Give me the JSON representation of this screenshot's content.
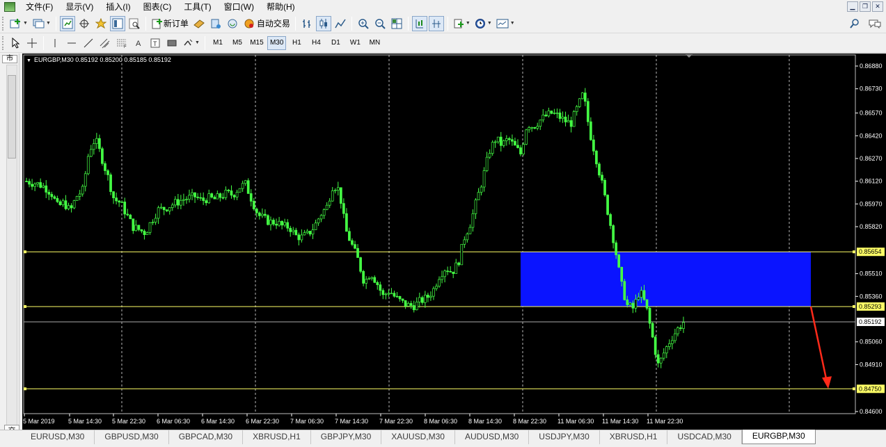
{
  "menu": [
    "文件(F)",
    "显示(V)",
    "插入(I)",
    "图表(C)",
    "工具(T)",
    "窗口(W)",
    "帮助(H)"
  ],
  "toolbar": {
    "new_order_label": "新订单",
    "auto_trading_label": "自动交易"
  },
  "timeframes": [
    "M1",
    "M5",
    "M15",
    "M30",
    "H1",
    "H4",
    "D1",
    "W1",
    "MN"
  ],
  "active_timeframe": "M30",
  "left_panel": {
    "tab_top": "市",
    "tab_bottom": "交"
  },
  "chart": {
    "title": "EURGBP,M30  0.85192 0.85200 0.85185 0.85192"
  },
  "chart_data": {
    "type": "candlestick",
    "symbol": "EURGBP",
    "timeframe": "M30",
    "ohlc_shown": {
      "open": 0.85192,
      "high": 0.852,
      "low": 0.85185,
      "close": 0.85192
    },
    "x_tick_labels": [
      "5 Mar 2019",
      "5 Mar 14:30",
      "5 Mar 22:30",
      "6 Mar 06:30",
      "6 Mar 14:30",
      "6 Mar 22:30",
      "7 Mar 06:30",
      "7 Mar 14:30",
      "7 Mar 22:30",
      "8 Mar 06:30",
      "8 Mar 14:30",
      "8 Mar 22:30",
      "11 Mar 06:30",
      "11 Mar 14:30",
      "11 Mar 22:30"
    ],
    "y_tick_labels": [
      "0.86880",
      "0.86730",
      "0.86570",
      "0.86420",
      "0.86270",
      "0.86120",
      "0.85970",
      "0.85820",
      "0.85510",
      "0.85360",
      "0.85060",
      "0.84910",
      "0.84600"
    ],
    "ylim": [
      0.846,
      0.8688
    ],
    "close_series": [
      0.8612,
      0.8611,
      0.861,
      0.8608,
      0.8604,
      0.8595,
      0.8598,
      0.8592,
      0.8602,
      0.8606,
      0.8632,
      0.864,
      0.8628,
      0.8615,
      0.86,
      0.8598,
      0.859,
      0.8582,
      0.858,
      0.8578,
      0.8586,
      0.8593,
      0.8594,
      0.8596,
      0.8598,
      0.86,
      0.8601,
      0.8602,
      0.8599,
      0.8601,
      0.86,
      0.8602,
      0.8604,
      0.8603,
      0.8608,
      0.861,
      0.86,
      0.859,
      0.8587,
      0.8585,
      0.8585,
      0.8582,
      0.8582,
      0.8576,
      0.8575,
      0.8577,
      0.8582,
      0.859,
      0.8595,
      0.861,
      0.8606,
      0.858,
      0.857,
      0.856,
      0.8545,
      0.8552,
      0.8545,
      0.8536,
      0.854,
      0.8535,
      0.8532,
      0.853,
      0.853,
      0.8533,
      0.8535,
      0.854,
      0.855,
      0.8555,
      0.8552,
      0.8558,
      0.8575,
      0.8585,
      0.86,
      0.8615,
      0.8632,
      0.864,
      0.8636,
      0.864,
      0.8635,
      0.863,
      0.865,
      0.8648,
      0.8652,
      0.8655,
      0.8657,
      0.8655,
      0.8652,
      0.865,
      0.866,
      0.867,
      0.8645,
      0.8628,
      0.861,
      0.859,
      0.857,
      0.8545,
      0.853,
      0.8528,
      0.854,
      0.853,
      0.851,
      0.849,
      0.85,
      0.8508,
      0.8514,
      0.8519
    ],
    "horizontal_levels": [
      0.85654,
      0.85293,
      0.85192,
      0.8475
    ],
    "zone": {
      "top": 0.85654,
      "bottom": 0.85293,
      "color": "#0a14ff"
    },
    "colors": {
      "background": "#000000",
      "candles": "#44ff44",
      "levels": "#ffff66",
      "grid": "#ffffff",
      "arrow": "#ff2a1a"
    }
  },
  "price_tags": {
    "upper": "0.85654",
    "lower": "0.85293",
    "current": "0.85192",
    "target": "0.84750"
  },
  "chart_tabs": [
    "EURUSD,M30",
    "GBPUSD,M30",
    "GBPCAD,M30",
    "XBRUSD,H1",
    "GBPJPY,M30",
    "XAUUSD,M30",
    "AUDUSD,M30",
    "USDJPY,M30",
    "XBRUSD,H1",
    "USDCAD,M30",
    "EURGBP,M30"
  ],
  "active_chart_tab": "EURGBP,M30"
}
